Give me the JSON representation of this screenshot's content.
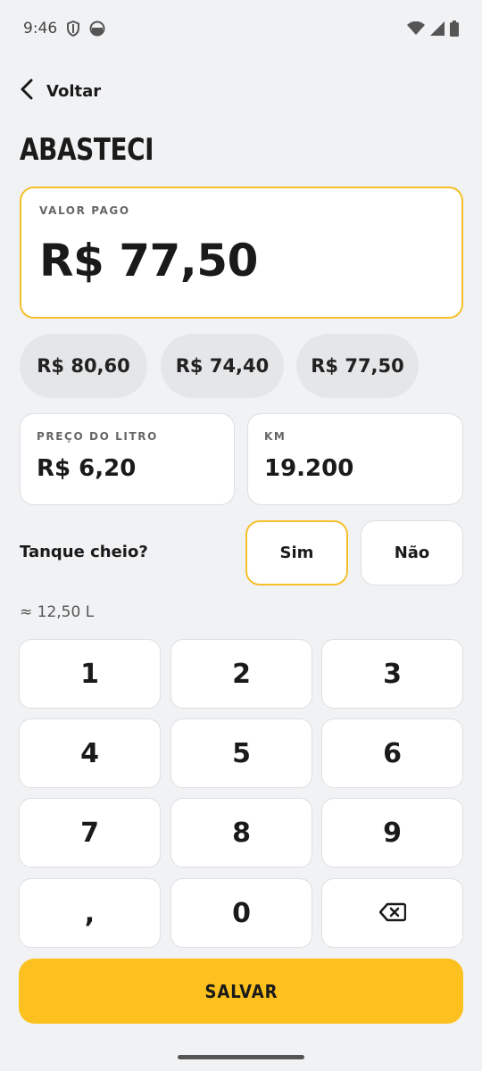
{
  "status": {
    "time": "9:46",
    "left_icons": [
      "shield-icon",
      "android-face-icon"
    ],
    "right_icons": [
      "wifi-icon",
      "signal-icon",
      "battery-icon"
    ]
  },
  "nav": {
    "back_label": "Voltar",
    "back_icon": "chevron-left-icon"
  },
  "title": "ABASTECI",
  "amount": {
    "label": "VALOR PAGO",
    "value": "R$ 77,50"
  },
  "suggestions": [
    "R$ 80,60",
    "R$ 74,40",
    "R$ 77,50"
  ],
  "price": {
    "label": "PREÇO DO LITRO",
    "value": "R$ 6,20"
  },
  "km": {
    "label": "KM",
    "value": "19.200"
  },
  "tank": {
    "question": "Tanque cheio?",
    "yes": "Sim",
    "no": "Não",
    "selected": "Sim"
  },
  "liters": "≈ 12,50 L",
  "keypad": [
    "1",
    "2",
    "3",
    "4",
    "5",
    "6",
    "7",
    "8",
    "9",
    ",",
    "0",
    "backspace-icon"
  ],
  "save_label": "SALVAR",
  "colors": {
    "accent": "#fcc11e",
    "accent_border": "#f5c02b",
    "background": "#f1f2f4"
  }
}
